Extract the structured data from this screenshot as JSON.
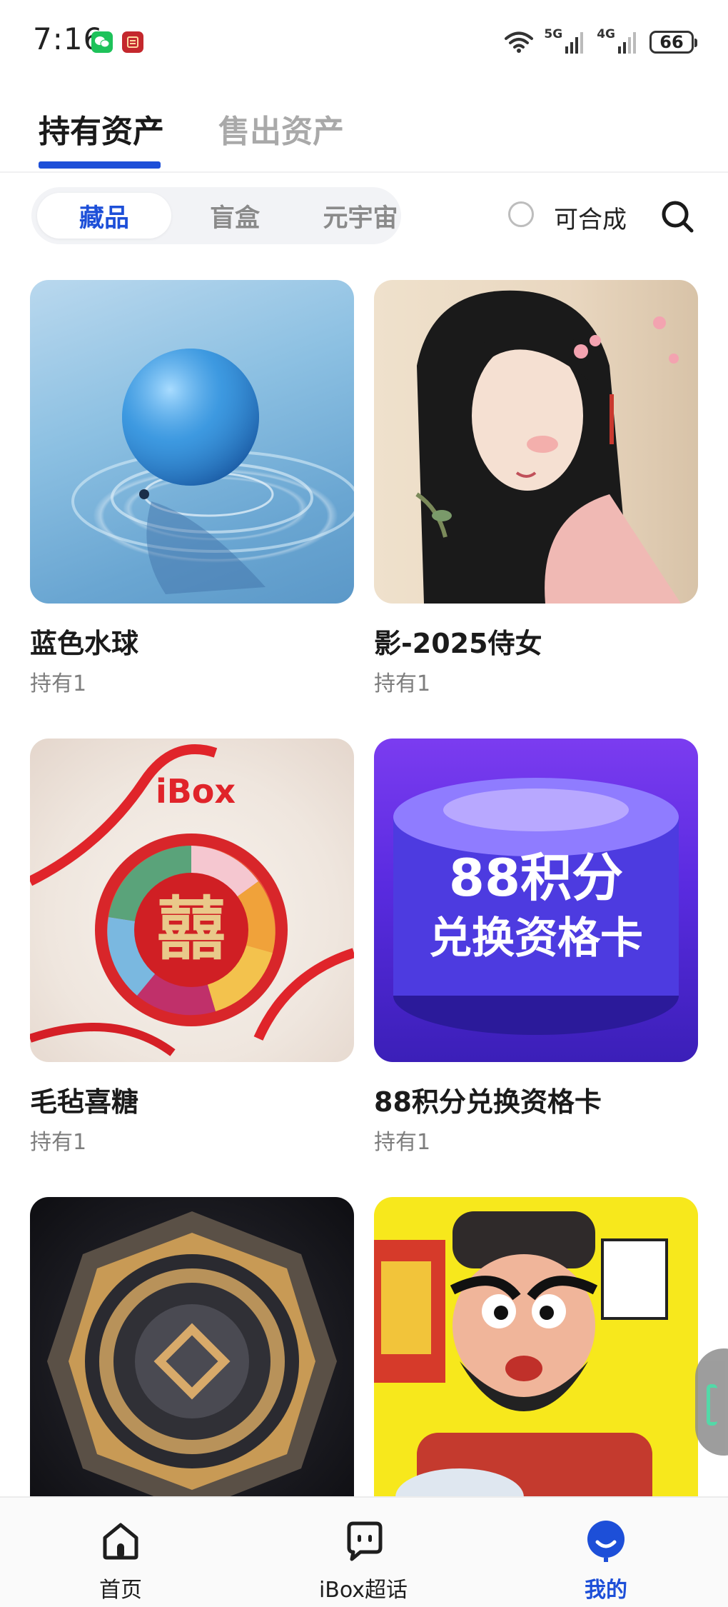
{
  "status_bar": {
    "time": "7:16",
    "network_5g": "5G",
    "network_4g": "4G",
    "battery": "66"
  },
  "top_tabs": {
    "active": "持有资产",
    "inactive": "售出资产"
  },
  "filter": {
    "segments": [
      "藏品",
      "盲盒",
      "元宇宙"
    ],
    "selected": "藏品",
    "composable_label": "可合成"
  },
  "items": [
    {
      "title": "蓝色水球",
      "holding": "持有1",
      "art": "blue-water-balloon"
    },
    {
      "title": "影-2025侍女",
      "holding": "持有1",
      "art": "maiden-painting"
    },
    {
      "title": "毛毡喜糖",
      "holding": "持有1",
      "art": "felt-wedding-candy"
    },
    {
      "title": "88积分兑换资格卡",
      "holding": "持有1",
      "art": "points-qualification-card"
    },
    {
      "title": "",
      "holding": "",
      "art": "golden-medal"
    },
    {
      "title": "",
      "holding": "",
      "art": "zhong-kui-cartoon"
    }
  ],
  "artwork_text": {
    "candy_brand": "iBox",
    "candy_symbol": "囍",
    "card_line1": "88积分",
    "card_line2": "兑换资格卡"
  },
  "bottom_nav": [
    {
      "label": "首页",
      "icon": "home-icon",
      "active": false
    },
    {
      "label": "iBox超话",
      "icon": "chat-icon",
      "active": false
    },
    {
      "label": "我的",
      "icon": "profile-icon",
      "active": true
    }
  ],
  "colors": {
    "accent": "#1d4fd8",
    "inactive_text": "#a9a9a9",
    "secondary_text": "#7d7d7d"
  }
}
